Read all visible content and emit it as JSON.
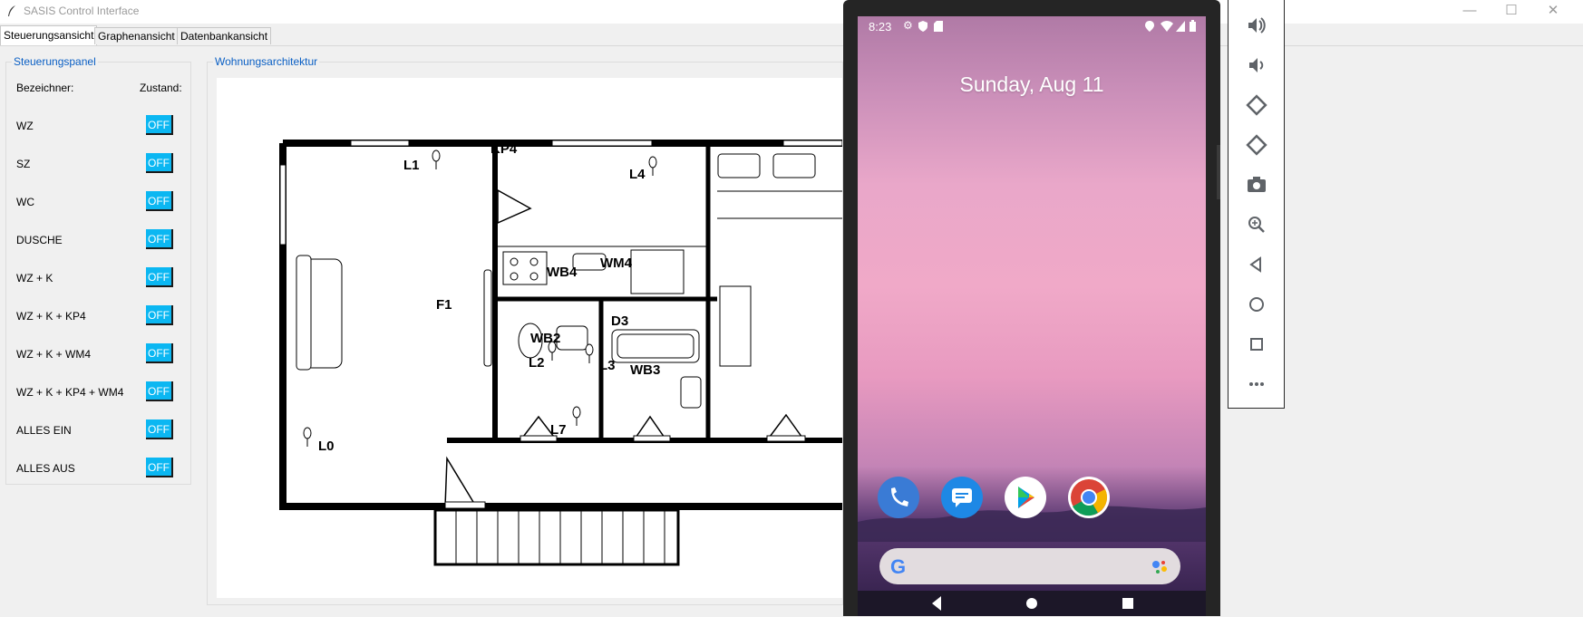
{
  "window": {
    "title": "SASIS Control Interface",
    "controls": {
      "minimize": "—",
      "maximize": "☐",
      "close": "✕"
    }
  },
  "tabs": [
    {
      "label": "Steuerungsansicht",
      "active": true
    },
    {
      "label": "Graphenansicht",
      "active": false
    },
    {
      "label": "Datenbankansicht",
      "active": false
    }
  ],
  "control_panel": {
    "title": "Steuerungspanel",
    "header_name": "Bezeichner:",
    "header_state": "Zustand:",
    "button_color": "#0bb7f2",
    "rows": [
      {
        "label": "WZ",
        "state": "OFF"
      },
      {
        "label": "SZ",
        "state": "OFF"
      },
      {
        "label": "WC",
        "state": "OFF"
      },
      {
        "label": "DUSCHE",
        "state": "OFF"
      },
      {
        "label": "WZ + K",
        "state": "OFF"
      },
      {
        "label": "WZ + K + KP4",
        "state": "OFF"
      },
      {
        "label": "WZ + K + WM4",
        "state": "OFF"
      },
      {
        "label": "WZ + K + KP4 + WM4",
        "state": "OFF"
      },
      {
        "label": "ALLES EIN",
        "state": "OFF"
      },
      {
        "label": "ALLES AUS",
        "state": "OFF"
      }
    ]
  },
  "architecture": {
    "title": "Wohnungsarchitektur",
    "labels": {
      "L0": "L0",
      "L1": "L1",
      "L2": "L2",
      "L3": "L3",
      "L4": "L4",
      "L7": "L7",
      "KP4": "KP4",
      "WB4": "WB4",
      "WM4": "WM4",
      "WB2": "WB2",
      "WB3": "WB3",
      "D3": "D3",
      "F1": "F1"
    }
  },
  "emulator": {
    "status_time": "8:23",
    "date_text": "Sunday, Aug 11",
    "dock_apps": [
      "phone-icon",
      "messages-icon",
      "play-store-icon",
      "chrome-icon"
    ],
    "search_logo": "G",
    "toolbar": [
      "volume-up-icon",
      "volume-down-icon",
      "rotate-left-icon",
      "rotate-right-icon",
      "camera-icon",
      "zoom-icon",
      "back-icon",
      "home-icon",
      "overview-icon",
      "more-icon"
    ]
  }
}
